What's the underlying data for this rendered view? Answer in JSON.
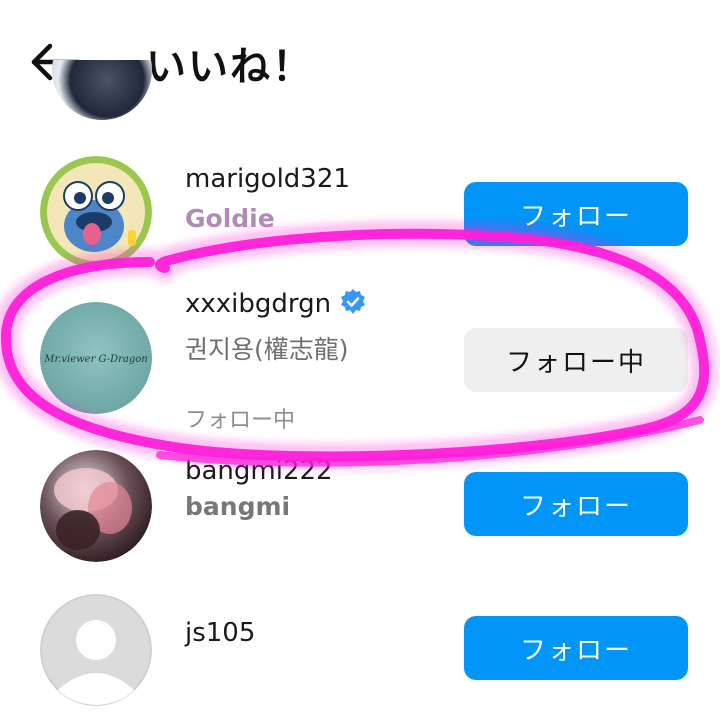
{
  "header": {
    "title": "いいね！"
  },
  "users": [
    {
      "username": "marigold321",
      "display_name": "Goldie",
      "button": "フォロー"
    },
    {
      "username": "xxxibgdrgn",
      "display_name": "권지용(權志龍)",
      "status": "フォロー中",
      "button": "フォロー中",
      "verified": true,
      "avatar_text": "Mr.viewer G-Dragon"
    },
    {
      "username": "bangmi222",
      "display_name": "bangmi",
      "button": "フォロー"
    },
    {
      "username": "js105",
      "display_name": "",
      "button": "フォロー"
    }
  ],
  "colors": {
    "follow_button": "#0095f6",
    "following_button": "#efefef",
    "highlight_marker": "#ff1fd9",
    "verified_badge": "#3897f0"
  }
}
